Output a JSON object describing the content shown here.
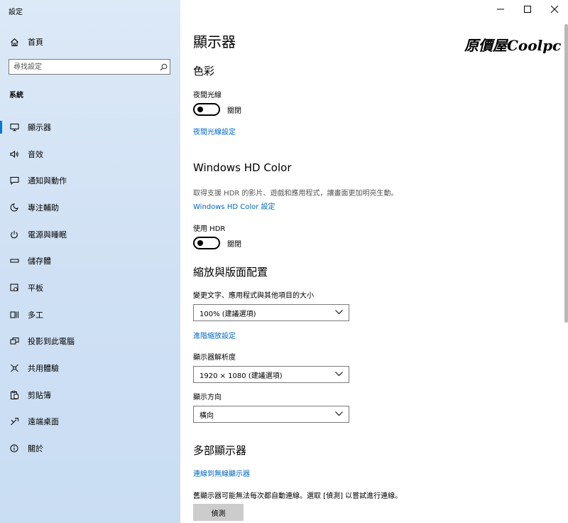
{
  "app": {
    "title": "設定"
  },
  "sidebar": {
    "home_label": "首頁",
    "search_placeholder": "尋找設定",
    "section": "系統",
    "items": [
      {
        "label": "顯示器",
        "icon": "monitor-icon"
      },
      {
        "label": "音效",
        "icon": "speaker-icon"
      },
      {
        "label": "通知與動作",
        "icon": "notification-icon"
      },
      {
        "label": "專注輔助",
        "icon": "moon-icon"
      },
      {
        "label": "電源與睡眠",
        "icon": "power-icon"
      },
      {
        "label": "儲存體",
        "icon": "storage-icon"
      },
      {
        "label": "平板",
        "icon": "tablet-icon"
      },
      {
        "label": "多工",
        "icon": "multitask-icon"
      },
      {
        "label": "投影到此電腦",
        "icon": "project-icon"
      },
      {
        "label": "共用體驗",
        "icon": "shared-icon"
      },
      {
        "label": "剪貼簿",
        "icon": "clipboard-icon"
      },
      {
        "label": "遠端桌面",
        "icon": "remote-icon"
      },
      {
        "label": "關於",
        "icon": "info-icon"
      }
    ]
  },
  "watermark": "原價屋Coolpc",
  "main": {
    "title": "顯示器",
    "color": {
      "heading": "色彩",
      "night_light_label": "夜間光線",
      "night_light_state": "關閉",
      "night_light_link": "夜間光線設定"
    },
    "hd_color": {
      "heading": "Windows HD Color",
      "description": "取得支援 HDR 的影片、遊戲和應用程式，讓畫面更加明亮生動。",
      "settings_link": "Windows HD Color 設定",
      "hdr_label": "使用 HDR",
      "hdr_state": "關閉"
    },
    "scale": {
      "heading": "縮放與版面配置",
      "size_label": "變更文字、應用程式與其他項目的大小",
      "size_value": "100% (建議選項)",
      "advanced_link": "進階縮放設定",
      "resolution_label": "顯示器解析度",
      "resolution_value": "1920 × 1080 (建議選項)",
      "orientation_label": "顯示方向",
      "orientation_value": "橫向"
    },
    "multi": {
      "heading": "多部顯示器",
      "wireless_link": "連線到無線顯示器",
      "hint": "舊顯示器可能無法每次都自動連線。選取 [偵測] 以嘗試進行連線。",
      "detect_label": "偵測"
    }
  },
  "colors": {
    "accent": "#0078d7",
    "link": "#0067c0"
  }
}
